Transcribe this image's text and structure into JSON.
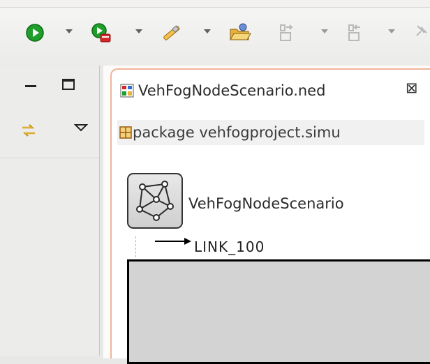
{
  "toolbar": {
    "buttons": [
      {
        "name": "run-icon",
        "color": "#1f9e2c"
      },
      {
        "name": "debug-run-icon",
        "color": "#1f9e2c"
      },
      {
        "name": "tool-wand-icon",
        "color": "#e8b23a"
      },
      {
        "name": "open-folder-icon",
        "color": "#e8b23a"
      },
      {
        "name": "next-annotation-icon",
        "color": "#b9b9b9"
      },
      {
        "name": "previous-annotation-icon",
        "color": "#b9b9b9"
      },
      {
        "name": "pin-icon",
        "color": "#b9b9b9"
      }
    ]
  },
  "left_panel": {
    "minimize_label": "minimize",
    "maximize_label": "maximize"
  },
  "editor": {
    "tab_title": "VehFogNodeScenario.ned",
    "tab_close": "⊠",
    "package_text": "package vehfogproject.simu",
    "network_name": "VehFogNodeScenario",
    "link_label": "LINK_100"
  }
}
